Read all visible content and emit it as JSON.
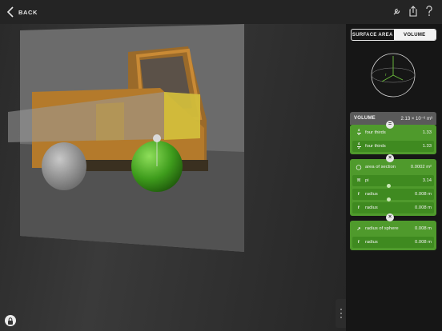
{
  "topbar": {
    "back_label": "BACK",
    "icons": [
      "wrench-icon",
      "share-icon",
      "help-icon"
    ]
  },
  "viewport": {
    "scene": "toy dump truck with wheel volume overlay",
    "lock_icon": "lock-icon"
  },
  "segmented": {
    "options": [
      "SURFACE AREA",
      "VOLUME"
    ],
    "selected": "VOLUME"
  },
  "diagram": {
    "icon": "sphere-radius-icon",
    "label": "r"
  },
  "result": {
    "label": "VOLUME",
    "value": "2.13 × 10⁻⁶ m³"
  },
  "cards": [
    {
      "operator": "=",
      "rows": [
        {
          "symbol": "4/3",
          "label": "four thirds",
          "value": "1.33"
        },
        {
          "symbol": "4/3",
          "label": "four thirds",
          "value": "1.33"
        }
      ]
    },
    {
      "operator": "×",
      "rows": [
        {
          "symbol": "◯",
          "label": "area of section",
          "value": "0.0002 m²"
        },
        {
          "symbol": "π",
          "label": "pi",
          "value": "3.14"
        },
        {
          "symbol": "r",
          "label": "radius",
          "value": "0.008 m"
        },
        {
          "symbol": "r",
          "label": "radius",
          "value": "0.008 m"
        }
      ]
    },
    {
      "operator": "×",
      "rows": [
        {
          "symbol": "↗",
          "label": "radius of sphere",
          "value": "0.008 m"
        },
        {
          "symbol": "r",
          "label": "radius",
          "value": "0.008 m"
        }
      ]
    }
  ],
  "colors": {
    "accent_green": "#4f9a2c",
    "row_green": "#3f8a20",
    "panel_bg": "#161616"
  }
}
